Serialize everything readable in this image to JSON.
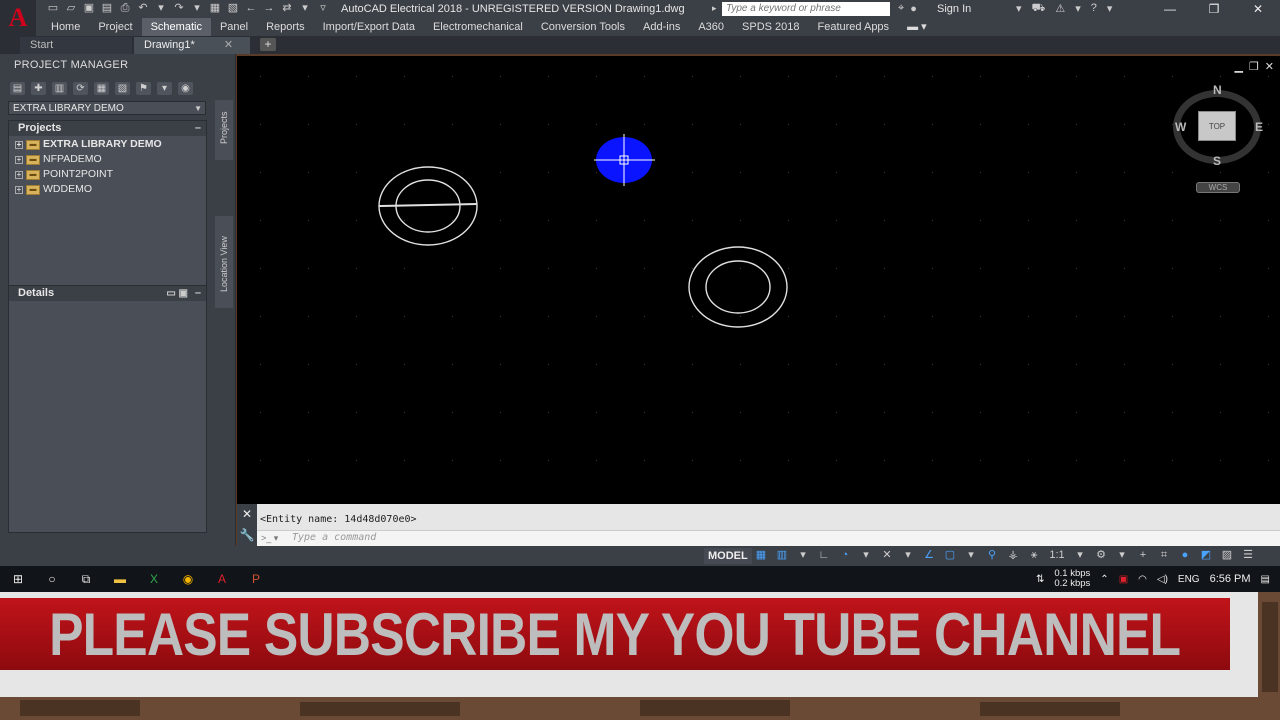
{
  "app": {
    "logo_letter": "A",
    "title": "AutoCAD Electrical 2018 - UNREGISTERED VERSION    Drawing1.dwg",
    "search_placeholder": "Type a keyword or phrase",
    "sign_in": "Sign In"
  },
  "ribbon_tabs": [
    {
      "label": "Home"
    },
    {
      "label": "Project"
    },
    {
      "label": "Schematic"
    },
    {
      "label": "Panel"
    },
    {
      "label": "Reports"
    },
    {
      "label": "Import/Export Data"
    },
    {
      "label": "Electromechanical"
    },
    {
      "label": "Conversion Tools"
    },
    {
      "label": "Add-ins"
    },
    {
      "label": "A360"
    },
    {
      "label": "SPDS 2018"
    },
    {
      "label": "Featured Apps"
    }
  ],
  "doc_tabs": {
    "start": "Start",
    "active": "Drawing1*"
  },
  "project_manager": {
    "title": "PROJECT MANAGER",
    "selected_project": "EXTRA LIBRARY DEMO",
    "projects_header": "Projects",
    "projects": [
      "EXTRA LIBRARY DEMO",
      "NFPADEMO",
      "POINT2POINT",
      "WDDEMO"
    ],
    "details_header": "Details",
    "vtab_projects": "Projects",
    "vtab_location": "Location View"
  },
  "viewcube": {
    "north": "N",
    "south": "S",
    "east": "E",
    "west": "W",
    "face": "TOP",
    "wcs": "WCS"
  },
  "command": {
    "history": "<Entity name: 14d48d070e0>",
    "placeholder": "Type a command"
  },
  "status": {
    "model": "MODEL",
    "scale": "1:1"
  },
  "taskbar": {
    "net_up": "0.1 kbps",
    "net_down": "0.2 kbps",
    "lang": "ENG",
    "time": "6:56 PM"
  },
  "banner": {
    "text": "PLEASE SUBSCRIBE MY YOU TUBE CHANNEL"
  },
  "colors": {
    "canvas": "#000000",
    "selected_fill": "#0a14ff",
    "banner_red": "#b3121a"
  }
}
